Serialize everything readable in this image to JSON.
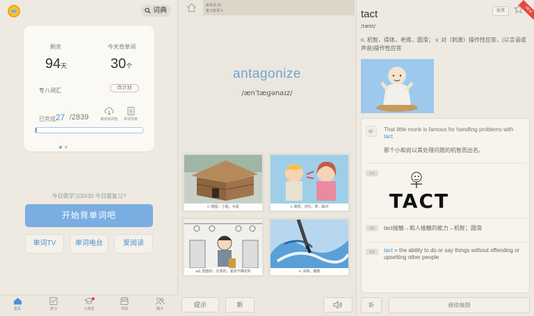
{
  "left": {
    "dict_label": "词典",
    "stats": {
      "remaining_label": "剩余",
      "remaining_value": "94",
      "remaining_unit": "天",
      "today_label": "今天背单词",
      "today_value": "30",
      "today_unit": "个"
    },
    "vocab_name": "专八词汇",
    "change_label": "改计划",
    "done_label": "已完成",
    "done_value": "27",
    "done_total": "/2839",
    "download_label": "离线单词包",
    "wordlist_label": "单词列表",
    "progress_fraction": 0.0095,
    "today_text": "今日需学习30/30 今日需复习?",
    "start_label": "开始背单词吧",
    "features": [
      "单词TV",
      "单词电台",
      "爱阅读"
    ],
    "tabs": [
      "首页",
      "复习",
      "小课堂",
      "商场",
      "圈子"
    ],
    "accent": "#4d8fd0"
  },
  "mid": {
    "progress_line1": "新单词 30",
    "progress_line2": "复习单词 4",
    "word": "antagonize",
    "phonetic": "/ænˈtæɡənaɪz/",
    "options": [
      {
        "caption": "n. 棚屋，小屋；木屋"
      },
      {
        "caption": "v. 激怒，对抗，使…敌对"
      },
      {
        "caption": "adj. 困惑的，在意的，紧张不确定的"
      },
      {
        "caption": "n. 涂抹，播散"
      }
    ],
    "hint_label": "提示",
    "new_label": "新"
  },
  "right": {
    "word": "tact",
    "phonetic": "/tækt/",
    "report_label": "报错",
    "new_badge": "NEW",
    "definition": "n. 机智，得体，老练，圆滑； v. 对（刺激）操作性应答，(以言语或声音)操作性应答",
    "example_en_pre": "That little monk is famous for handling problems with ",
    "example_en_hl": "tact",
    "example_en_post": ".",
    "example_cn": "那个小和尚以其处理问题的机智而出名。",
    "tag1": "助记",
    "logo_text": "TACT",
    "tag2": "词根",
    "note1": "tact接触→和人接触的能力→机智；圆滑",
    "tag3": "英英",
    "note2_hl": "tact",
    "note2_rest": " = the ability to do or say things without offending or upsetting other people",
    "bottom_left": "斩",
    "bottom_right": "继续做题"
  }
}
